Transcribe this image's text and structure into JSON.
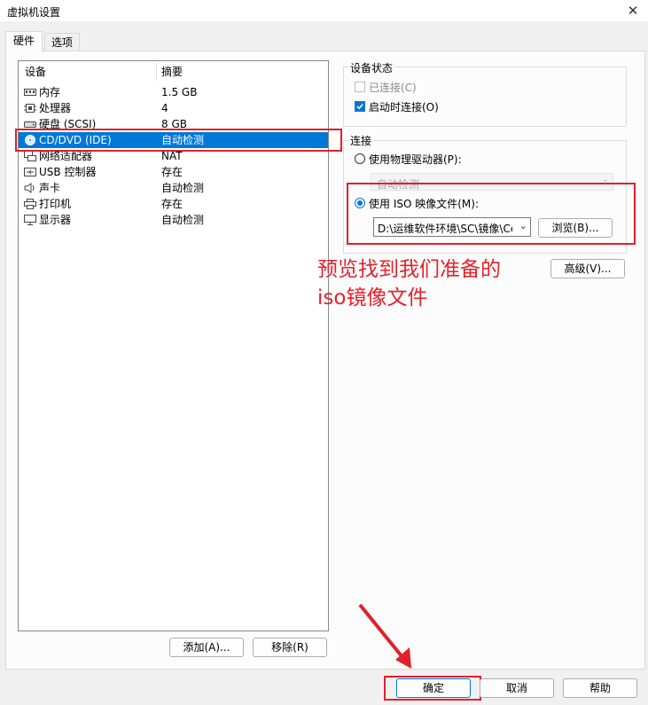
{
  "window": {
    "title": "虚拟机设置"
  },
  "tabs": [
    {
      "label": "硬件"
    },
    {
      "label": "选项"
    }
  ],
  "device_list": {
    "headers": {
      "device": "设备",
      "summary": "摘要"
    },
    "rows": [
      {
        "name": "内存",
        "summary": "1.5 GB",
        "icon": "memory-icon"
      },
      {
        "name": "处理器",
        "summary": "4",
        "icon": "processor-icon"
      },
      {
        "name": "硬盘 (SCSI)",
        "summary": "8 GB",
        "icon": "hard-disk-icon"
      },
      {
        "name": "CD/DVD (IDE)",
        "summary": "自动检测",
        "icon": "cd-dvd-icon",
        "selected": true
      },
      {
        "name": "网络适配器",
        "summary": "NAT",
        "icon": "network-adapter-icon"
      },
      {
        "name": "USB 控制器",
        "summary": "存在",
        "icon": "usb-icon"
      },
      {
        "name": "声卡",
        "summary": "自动检测",
        "icon": "sound-card-icon"
      },
      {
        "name": "打印机",
        "summary": "存在",
        "icon": "printer-icon"
      },
      {
        "name": "显示器",
        "summary": "自动检测",
        "icon": "display-icon"
      }
    ]
  },
  "list_buttons": {
    "add": "添加(A)...",
    "remove": "移除(R)"
  },
  "device_status": {
    "title": "设备状态",
    "connected": {
      "label": "已连接(C)",
      "checked": false,
      "enabled": false
    },
    "connect_at_power_on": {
      "label": "启动时连接(O)",
      "checked": true
    }
  },
  "connection": {
    "title": "连接",
    "physical_drive": {
      "label": "使用物理驱动器(P):",
      "selected": false
    },
    "physical_drive_select": "自动检测",
    "iso_image": {
      "label": "使用 ISO 映像文件(M):",
      "selected": true
    },
    "iso_path": "D:\\运维软件环境\\SC\\镜像\\Ce",
    "browse": "浏览(B)..."
  },
  "advanced": "高级(V)...",
  "annotation": {
    "line1": "预览找到我们准备的",
    "line2": "iso镜像文件",
    "color": "#e8202a"
  },
  "footer": {
    "ok": "确定",
    "cancel": "取消",
    "help": "帮助"
  },
  "colors": {
    "selection": "#0078d7",
    "annotation": "#e8202a"
  }
}
